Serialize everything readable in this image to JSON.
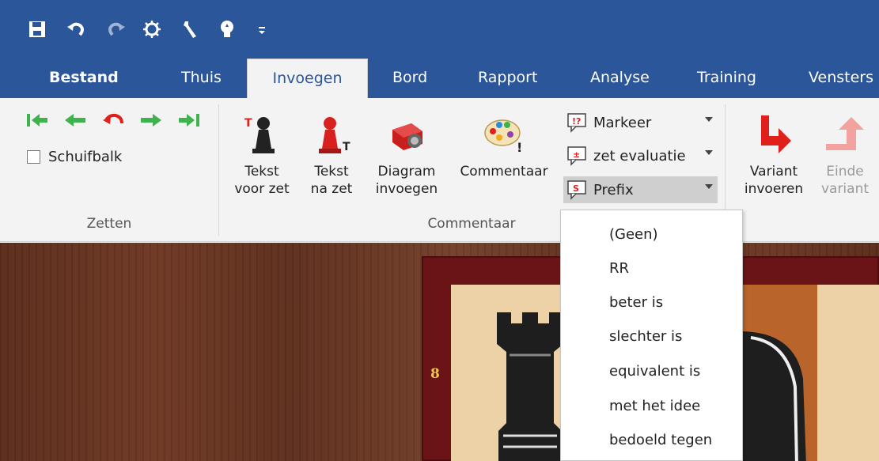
{
  "quick_access": {
    "icons": [
      "save-icon",
      "undo-icon",
      "redo-icon",
      "engine-icon",
      "tools-icon",
      "bulb-icon",
      "customize-qat-icon"
    ]
  },
  "tabs": [
    {
      "label": "Bestand"
    },
    {
      "label": "Thuis"
    },
    {
      "label": "Invoegen"
    },
    {
      "label": "Bord"
    },
    {
      "label": "Rapport"
    },
    {
      "label": "Analyse"
    },
    {
      "label": "Training"
    },
    {
      "label": "Vensters"
    }
  ],
  "ribbon": {
    "zetten": {
      "label": "Zetten",
      "checkbox_label": "Schuifbalk",
      "nav_icons": [
        "first-move-icon",
        "previous-move-icon",
        "take-back-icon",
        "next-move-icon",
        "last-move-icon"
      ]
    },
    "commentaar": {
      "label": "Commentaar",
      "buttons": [
        {
          "line1": "Tekst",
          "line2": "voor zet"
        },
        {
          "line1": "Tekst",
          "line2": "na zet"
        },
        {
          "line1": "Diagram",
          "line2": "invoegen"
        },
        {
          "line1": "Commentaar",
          "line2": ""
        }
      ],
      "small_buttons": [
        {
          "label": "Markeer"
        },
        {
          "label": "zet evaluatie"
        },
        {
          "label": "Prefix"
        }
      ]
    },
    "varianten": {
      "enter_line1": "Variant",
      "enter_line2": "invoeren",
      "end_line1": "Einde",
      "end_line2": "variant"
    }
  },
  "board": {
    "rank_label": "8"
  },
  "prefix_menu": {
    "items": [
      "(Geen)",
      "RR",
      "beter is",
      "slechter is",
      "equivalent is",
      "met het idee",
      "bedoeld tegen"
    ]
  },
  "colors": {
    "title_bar": "#2b579a",
    "ribbon_bg": "#f3f3f3",
    "active_tab_text": "#2b579a",
    "nav_green": "#3cb44b",
    "variant_red": "#e0201b"
  }
}
